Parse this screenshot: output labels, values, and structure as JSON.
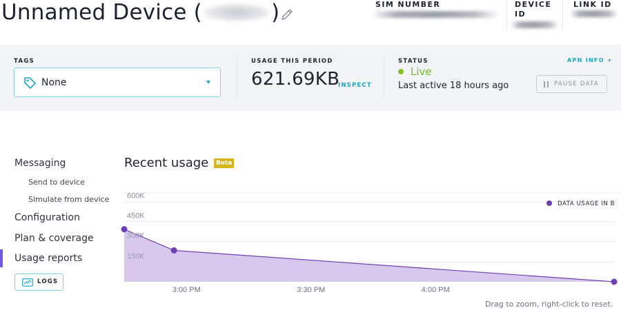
{
  "header": {
    "title_prefix": "Unnamed Device (",
    "title_suffix": ")",
    "sim_number_label": "SIM NUMBER",
    "device_id_label": "DEVICE ID",
    "link_id_label": "LINK ID"
  },
  "tags": {
    "label": "TAGS",
    "value": "None"
  },
  "usage": {
    "label": "USAGE THIS PERIOD",
    "value": "621.69KB",
    "inspect_label": "INSPECT"
  },
  "status": {
    "label": "STATUS",
    "state": "Live",
    "last_active": "Last active 18 hours ago",
    "apn_info_label": "APN INFO +",
    "pause_label": "PAUSE DATA"
  },
  "sidebar": {
    "items": [
      {
        "label": "Messaging"
      },
      {
        "label": "Send to device"
      },
      {
        "label": "Simulate from device"
      },
      {
        "label": "Configuration"
      },
      {
        "label": "Plan & coverage"
      },
      {
        "label": "Usage reports"
      }
    ],
    "logs_label": "LOGS"
  },
  "chart": {
    "title": "Recent usage",
    "badge": "Beta",
    "hint": "Drag to zoom, right-click to reset."
  },
  "colors": {
    "accent_cyan": "#18a8c8",
    "live_green": "#6cbf24",
    "series_purple": "#6f3fb8",
    "area_fill": "#d3c3ec",
    "beta_badge": "#d7b51a",
    "active_nav": "#6e5ce6"
  },
  "chart_data": {
    "type": "area",
    "title": "",
    "xlabel": "",
    "ylabel": "",
    "ylim": [
      0,
      600000
    ],
    "yticks": [
      {
        "value": 600000,
        "label": "600K"
      },
      {
        "value": 450000,
        "label": "450K"
      },
      {
        "value": 300000,
        "label": "300K"
      },
      {
        "value": 150000,
        "label": "150K"
      }
    ],
    "xticks": [
      {
        "minutes": 180,
        "label": "3:00 PM"
      },
      {
        "minutes": 210,
        "label": "3:30 PM"
      },
      {
        "minutes": 240,
        "label": "4:00 PM"
      }
    ],
    "xlim_minutes": [
      165,
      283
    ],
    "legend_position": "top-right",
    "grid": true,
    "series": [
      {
        "name": "DATA USAGE IN B",
        "points": [
          {
            "minutes": 165,
            "value": 390000
          },
          {
            "minutes": 177,
            "value": 233000
          },
          {
            "minutes": 283,
            "value": 0
          }
        ]
      }
    ]
  }
}
